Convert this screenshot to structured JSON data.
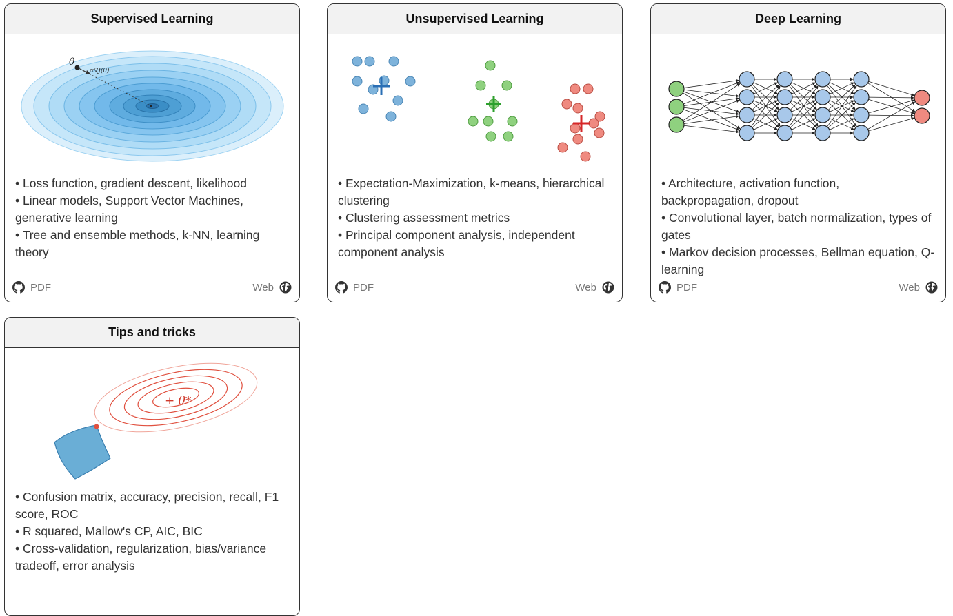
{
  "cards": [
    {
      "title": "Supervised Learning",
      "items": [
        "Loss function, gradient descent, likelihood",
        "Linear models, Support Vector Machines, generative learning",
        "Tree and ensemble methods, k-NN, learning theory"
      ],
      "pdf_label": "PDF",
      "web_label": "Web",
      "illus_theta": "θ",
      "illus_grad": "α∇J(θ)"
    },
    {
      "title": "Unsupervised Learning",
      "items": [
        "Expectation-Maximization, k-means, hierarchical clustering",
        "Clustering assessment metrics",
        "Principal component analysis, independent component analysis"
      ],
      "pdf_label": "PDF",
      "web_label": "Web"
    },
    {
      "title": "Deep Learning",
      "items": [
        "Architecture, activation function, backpropagation, dropout",
        "Convolutional layer, batch normalization, types of gates",
        "Markov decision processes, Bellman equation, Q-learning"
      ],
      "pdf_label": "PDF",
      "web_label": "Web"
    },
    {
      "title": "Tips and tricks",
      "items": [
        "Confusion matrix, accuracy, precision, recall, F1 score, ROC",
        "R squared, Mallow's CP, AIC, BIC",
        "Cross-validation, regularization, bias/variance tradeoff, error analysis"
      ],
      "illus_theta_star": "+ θ*"
    }
  ],
  "colors": {
    "blue_cluster": "#7eb3db",
    "green_cluster": "#8fd17f",
    "red_cluster": "#ef8a80",
    "nn_input": "#8fd17f",
    "nn_hidden": "#a8c8ea",
    "nn_output": "#ef8a80",
    "header_bg": "#f2f2f2"
  },
  "icons": {
    "pdf": "github-icon",
    "web": "globe-icon"
  }
}
